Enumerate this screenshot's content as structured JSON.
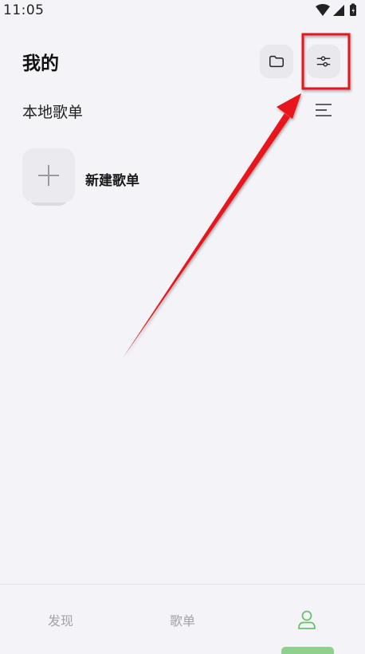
{
  "status_bar": {
    "time": "11:05",
    "icons": [
      "wifi-icon",
      "cellular-signal-icon",
      "battery-icon"
    ]
  },
  "header": {
    "title": "我的",
    "actions": [
      "folder-icon",
      "settings-sliders-icon"
    ]
  },
  "section": {
    "title": "本地歌单",
    "action": "sort-list-icon"
  },
  "playlist_list": {
    "new_playlist_label": "新建歌单",
    "new_playlist_icon": "plus-icon"
  },
  "bottom_nav": {
    "discover_label": "发现",
    "playlist_label": "歌单",
    "mine_icon": "person-icon",
    "active_tab": "mine"
  },
  "colors": {
    "background": "#f4f3f7",
    "accent": "#6cc06c",
    "annotation_red": "#e8141a"
  }
}
